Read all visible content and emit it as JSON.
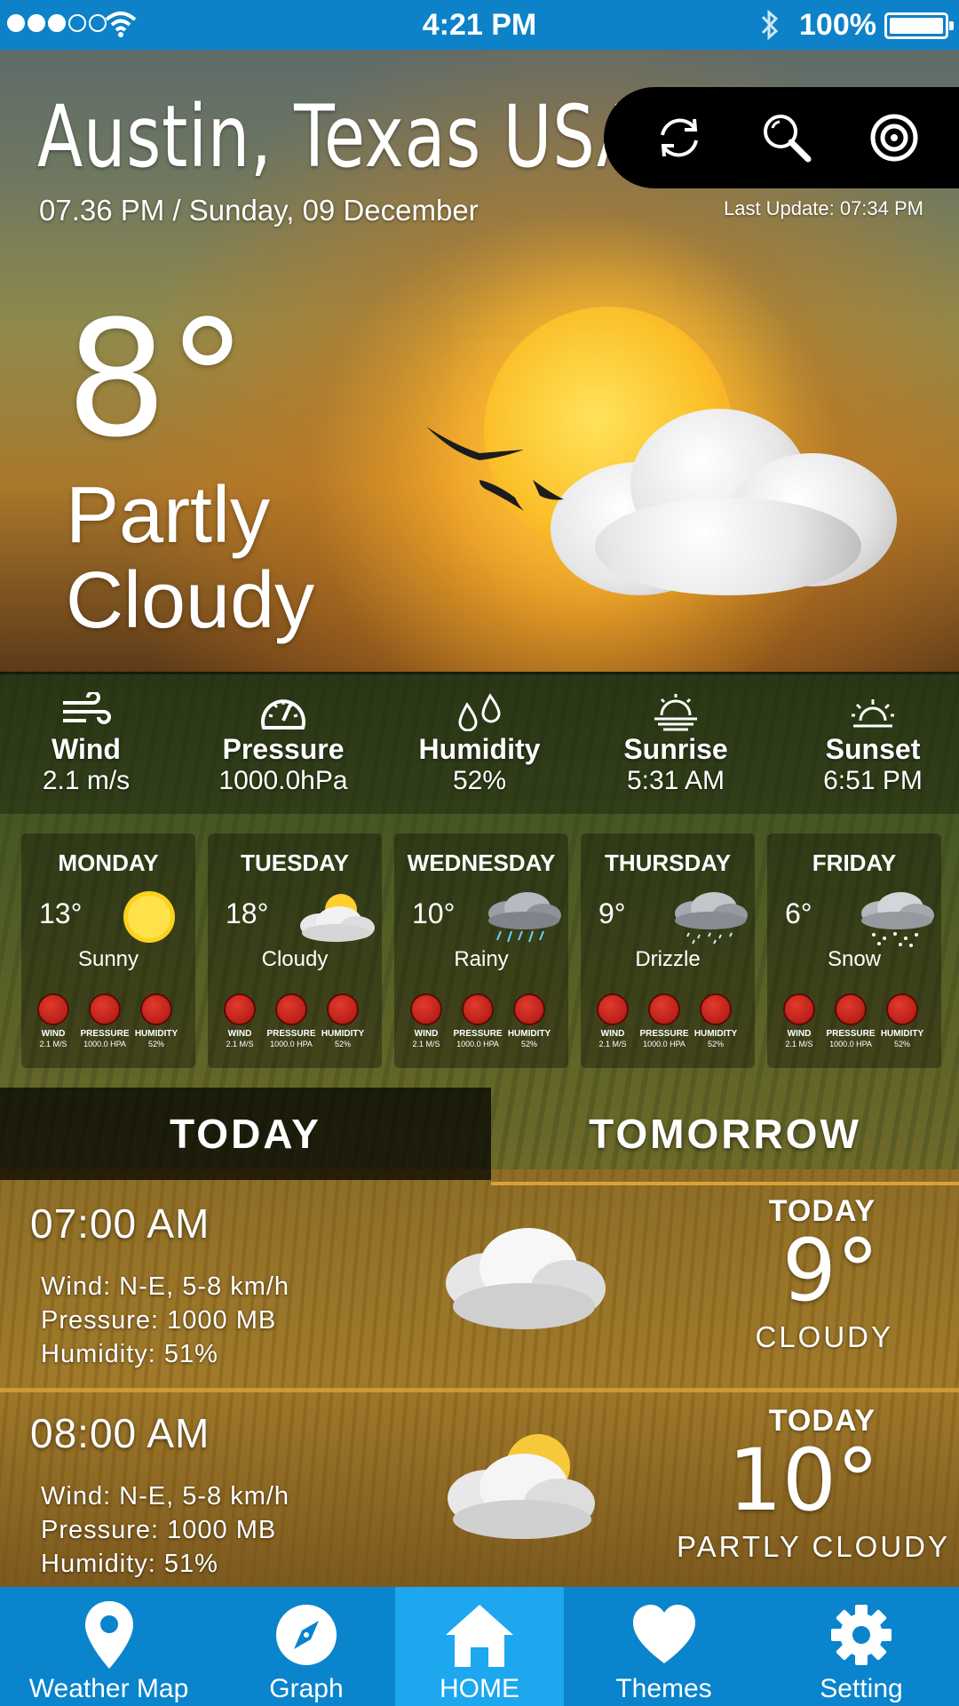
{
  "status_bar": {
    "time": "4:21 PM",
    "battery": "100%",
    "signal_dots_filled": 3,
    "signal_dots_total": 5
  },
  "header": {
    "city": "Austin, Texas USA",
    "datetime": "07.36 PM / Sunday, 09 December",
    "last_update": "Last Update: 07:34 PM",
    "toolbar_icons": [
      "refresh-icon",
      "search-icon",
      "location-target-icon"
    ]
  },
  "current": {
    "temperature": "8°",
    "condition": "Partly Cloudy"
  },
  "stats": [
    {
      "icon": "wind-icon",
      "label": "Wind",
      "value": "2.1 m/s"
    },
    {
      "icon": "gauge-icon",
      "label": "Pressure",
      "value": "1000.0hPa"
    },
    {
      "icon": "humidity-drops-icon",
      "label": "Humidity",
      "value": "52%"
    },
    {
      "icon": "sunrise-icon",
      "label": "Sunrise",
      "value": "5:31 AM"
    },
    {
      "icon": "sunset-icon",
      "label": "Sunset",
      "value": "6:51 PM"
    }
  ],
  "forecast": [
    {
      "day": "MONDAY",
      "temp": "13°",
      "condition": "Sunny",
      "icon": "sun-icon"
    },
    {
      "day": "TUESDAY",
      "temp": "18°",
      "condition": "Cloudy",
      "icon": "cloud-sun-icon"
    },
    {
      "day": "WEDNESDAY",
      "temp": "10°",
      "condition": "Rainy",
      "icon": "rain-cloud-icon"
    },
    {
      "day": "THURSDAY",
      "temp": "9°",
      "condition": "Drizzle",
      "icon": "drizzle-cloud-icon"
    },
    {
      "day": "FRIDAY",
      "temp": "6°",
      "condition": "Snow",
      "icon": "snow-cloud-icon"
    }
  ],
  "forecast_mini": {
    "wind_label": "WIND",
    "wind_value": "2.1 M/S",
    "pressure_label": "PRESSURE",
    "pressure_value": "1000.0 HPA",
    "humidity_label": "HUMIDITY",
    "humidity_value": "52%"
  },
  "tabs": {
    "today": "TODAY",
    "tomorrow": "TOMORROW"
  },
  "hourly": [
    {
      "time": "07:00 AM",
      "wind": "Wind: N-E, 5-8 km/h",
      "pressure": "Pressure: 1000 MB",
      "humidity": "Humidity: 51%",
      "day": "TODAY",
      "temp": "9°",
      "condition": "CLOUDY"
    },
    {
      "time": "08:00 AM",
      "wind": "Wind: N-E, 5-8 km/h",
      "pressure": "Pressure: 1000 MB",
      "humidity": "Humidity: 51%",
      "day": "TODAY",
      "temp": "10°",
      "condition": "PARTLY CLOUDY"
    }
  ],
  "nav": [
    {
      "label": "Weather Map",
      "icon": "map-pin-icon"
    },
    {
      "label": "Graph",
      "icon": "compass-icon"
    },
    {
      "label": "HOME",
      "icon": "home-icon",
      "active": true
    },
    {
      "label": "Themes",
      "icon": "heart-icon"
    },
    {
      "label": "Setting",
      "icon": "gear-icon"
    }
  ],
  "colors": {
    "status_bar": "#0d82c8",
    "nav_bar": "#0a84cc",
    "nav_active": "#1da7ef",
    "mini_stat_red": "#c4231a"
  }
}
